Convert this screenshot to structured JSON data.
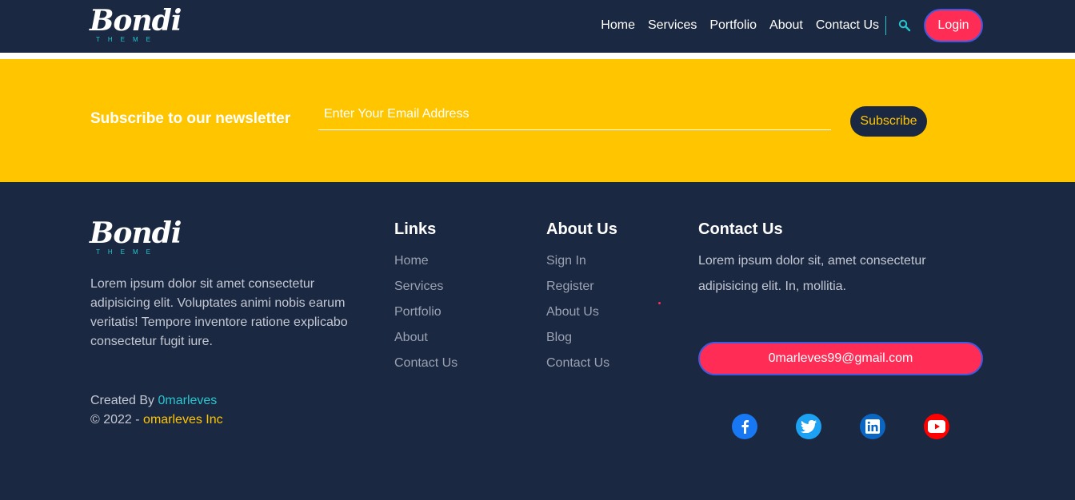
{
  "brand": {
    "name": "Bondi",
    "tagline": "THEME"
  },
  "nav": {
    "items": [
      "Home",
      "Services",
      "Portfolio",
      "About",
      "Contact Us"
    ],
    "login_label": "Login",
    "search_icon": "search-icon"
  },
  "newsletter": {
    "title": "Subscribe to our newsletter",
    "email_placeholder": "Enter Your Email Address",
    "button_label": "Subscribe"
  },
  "footer": {
    "about_text": "Lorem ipsum dolor sit amet consectetur adipisicing elit. Voluptates animi nobis earum veritatis! Tempore inventore ratione explicabo consectetur fugit iure.",
    "credits": {
      "created_by_label": "Created By ",
      "author": "0marleves",
      "copyright_prefix": "© 2022 - ",
      "company": "omarleves Inc"
    },
    "links": {
      "title": "Links",
      "items": [
        "Home",
        "Services",
        "Portfolio",
        "About",
        "Contact Us"
      ]
    },
    "about": {
      "title": "About Us",
      "items": [
        "Sign In",
        "Register",
        "About Us",
        "Blog",
        "Contact Us"
      ]
    },
    "contact": {
      "title": "Contact Us",
      "text": "Lorem ipsum dolor sit, amet consectetur adipisicing elit. In, mollitia.",
      "email": "0marleves99@gmail.com"
    },
    "socials": [
      "facebook-icon",
      "twitter-icon",
      "linkedin-icon",
      "youtube-icon"
    ]
  },
  "colors": {
    "navy": "#1b2841",
    "yellow": "#ffc600",
    "pink": "#ff2d55",
    "cyan": "#27c6ce"
  }
}
